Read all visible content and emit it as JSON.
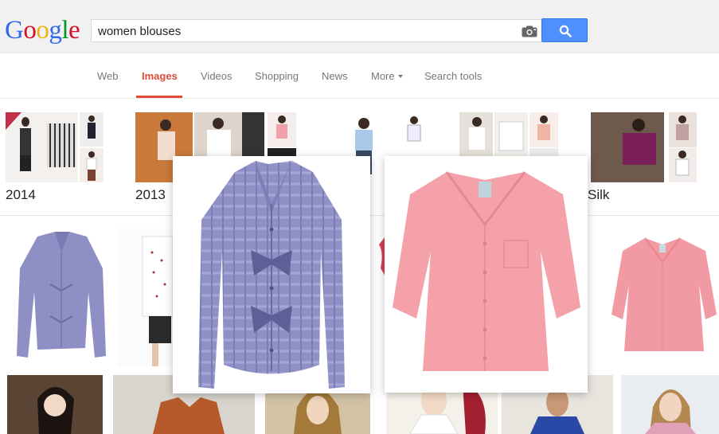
{
  "brand": {
    "logo_letters": [
      "G",
      "o",
      "o",
      "g",
      "l",
      "e"
    ],
    "logo_colors": [
      "#3369e8",
      "#d50f25",
      "#eeb211",
      "#3369e8",
      "#009925",
      "#d50f25"
    ],
    "accent": "#dd4b39",
    "search_button_color": "#4d90fe"
  },
  "search": {
    "query": "women blouses",
    "camera_icon": "camera-icon",
    "button_icon": "search-icon"
  },
  "nav": {
    "tabs": [
      {
        "label": "Web"
      },
      {
        "label": "Images"
      },
      {
        "label": "Videos"
      },
      {
        "label": "Shopping"
      },
      {
        "label": "News"
      },
      {
        "label": "More"
      },
      {
        "label": "Search tools"
      }
    ],
    "active_tab": "Images"
  },
  "related_searches": [
    {
      "label": "2014"
    },
    {
      "label": "2013"
    },
    {
      "label": ""
    },
    {
      "label": ""
    },
    {
      "label": "Silk"
    }
  ]
}
